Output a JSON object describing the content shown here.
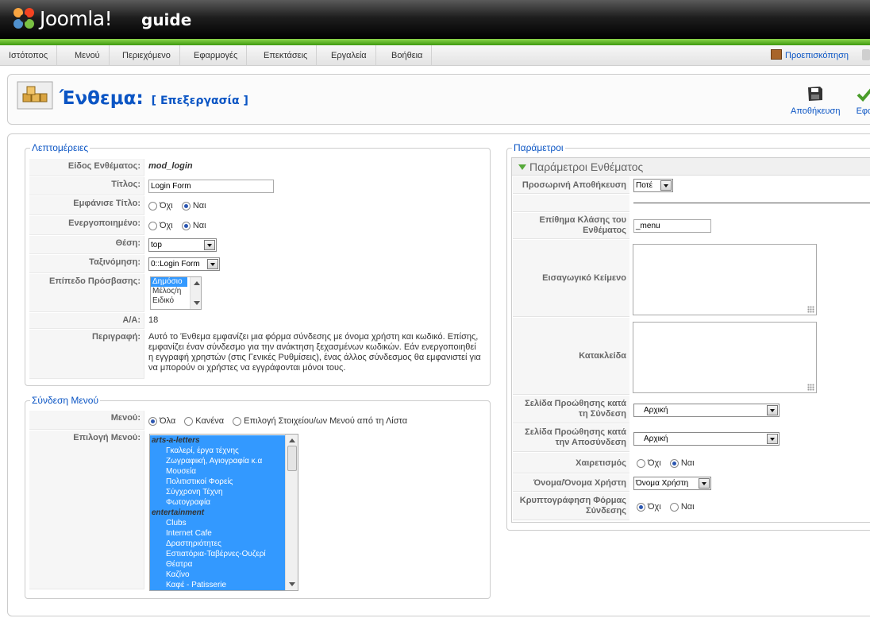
{
  "header": {
    "brand": "Joomla!",
    "site_name": "guide"
  },
  "menu": {
    "items": [
      "Ιστότοπος",
      "Μενού",
      "Περιεχόμενο",
      "Εφαρμογές",
      "Επεκτάσεις",
      "Εργαλεία",
      "Βοήθεια"
    ],
    "preview": "Προεπισκόπηση"
  },
  "toolbar": {
    "title": "Ένθεμα:",
    "subtitle": "[ Επεξεργασία ]",
    "save": "Αποθήκευση",
    "apply": "Εφα"
  },
  "details": {
    "legend": "Λεπτομέρειες",
    "type_label": "Είδος Ενθέματος:",
    "type_value": "mod_login",
    "title_label": "Τίτλος:",
    "title_value": "Login Form",
    "show_title_label": "Εμφάνισε Τίτλο:",
    "enabled_label": "Ενεργοποιημένο:",
    "no": "Όχι",
    "yes": "Ναι",
    "position_label": "Θέση:",
    "position_value": "top",
    "order_label": "Ταξινόμηση:",
    "order_value": "0::Login Form",
    "access_label": "Επίπεδο Πρόσβασης:",
    "access_options": [
      "Δημόσιο",
      "Μέλος/η",
      "Ειδικό"
    ],
    "id_label": "Α/Α:",
    "id_value": "18",
    "description_label": "Περιγραφή:",
    "description_lines": [
      "Αυτό το Ένθεμα εμφανίζει μια φόρμα σύνδεσης με όνομα χρήστη και κωδικό. Επίσης,",
      "εμφανίζει έναν σύνδεσμο για την ανάκτηση ξεχασμένων κωδικών. Εάν ενεργοποιηθεί",
      "η εγγραφή χρηστών (στις Γενικές Ρυθμίσεις), ένας άλλος σύνδεσμος θα εμφανιστεί για",
      "να μπορούν οι χρήστες να εγγράφονται μόνοι τους."
    ]
  },
  "menu_assign": {
    "legend": "Σύνδεση Μενού",
    "menus_label": "Μενού:",
    "opt_all": "Όλα",
    "opt_none": "Κανένα",
    "opt_select": "Επιλογή Στοιχείου/ων Μενού από τη Λίστα",
    "selection_label": "Επιλογή Μενού:",
    "list": [
      {
        "text": "arts-a-letters",
        "group": true
      },
      {
        "text": "Γκαλερί, έργα τέχνης"
      },
      {
        "text": "Ζωγραφική, Αγιογραφία κ.α"
      },
      {
        "text": "Μουσεία"
      },
      {
        "text": "Πολιτιστικοί Φορείς"
      },
      {
        "text": "Σύγχρονη Τέχνη"
      },
      {
        "text": "Φωτογραφία"
      },
      {
        "text": "entertainment",
        "group": true
      },
      {
        "text": "Clubs"
      },
      {
        "text": "Internet Cafe"
      },
      {
        "text": "Δραστηριότητες"
      },
      {
        "text": "Εστιατόρια-Ταβέρνες-Ουζερί"
      },
      {
        "text": "Θέατρα"
      },
      {
        "text": "Καζίνο"
      },
      {
        "text": "Καφέ - Patisserie"
      }
    ]
  },
  "params": {
    "legend": "Παράμετροι",
    "panel_title": "Παράμετροι Ενθέματος",
    "cache_label": "Προσωρινή Αποθήκευση",
    "cache_value": "Ποτέ",
    "suffix_label": "Επίθημα Κλάσης του Ενθέματος",
    "suffix_value": "_menu",
    "pretext_label": "Εισαγωγικό Κείμενο",
    "posttext_label": "Κατακλείδα",
    "login_redirect_label": "Σελίδα Προώθησης κατά τη Σύνδεση",
    "login_redirect_value": "Αρχική",
    "logout_redirect_label": "Σελίδα Προώθησης κατά την Αποσύνδεση",
    "logout_redirect_value": "Αρχική",
    "greeting_label": "Χαιρετισμός",
    "name_label": "Όνομα/Όνομα Χρήστη",
    "name_value": "Όνομα Χρήστη",
    "encrypt_label": "Κρυπτογράφηση Φόρμας Σύνδεσης",
    "no": "Όχι",
    "yes": "Ναι"
  }
}
